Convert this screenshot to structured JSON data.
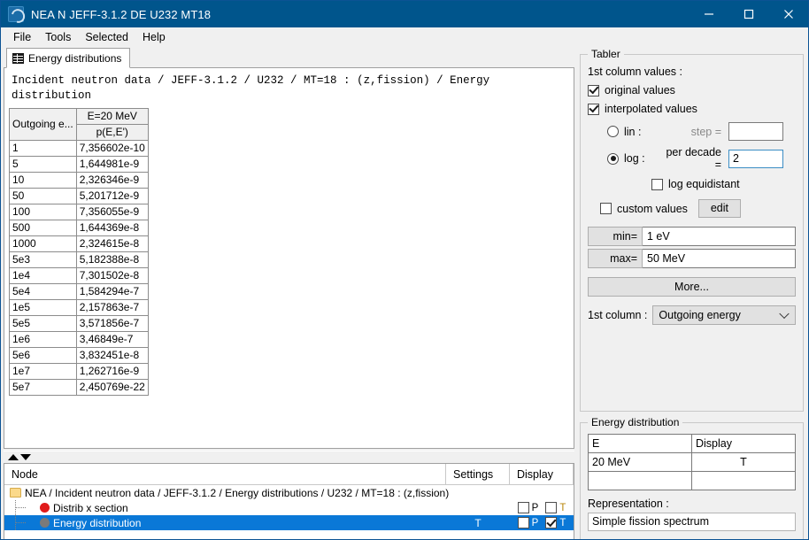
{
  "window": {
    "title": "NEA N JEFF-3.1.2 DE U232 MT18",
    "app_icon": "app-logo-icon",
    "minimize": "minimize-icon",
    "maximize": "maximize-icon",
    "close": "close-icon",
    "titlebar_color": "#00558c"
  },
  "menubar": {
    "items": [
      "File",
      "Tools",
      "Selected",
      "Help"
    ]
  },
  "tabs": [
    {
      "label": "Energy distributions",
      "icon": "grid-icon",
      "active": true
    }
  ],
  "main": {
    "header": "Incident neutron data / JEFF-3.1.2 / U232 / MT=18 : (z,fission) / Energy distribution",
    "table": {
      "col1_header": "Outgoing e...",
      "col2_header_top": "E=20 MeV",
      "col2_header_sub": "p(E,E')",
      "rows": [
        {
          "e": "1",
          "p": "7,356602e-10"
        },
        {
          "e": "5",
          "p": "1,644981e-9"
        },
        {
          "e": "10",
          "p": "2,326346e-9"
        },
        {
          "e": "50",
          "p": "5,201712e-9"
        },
        {
          "e": "100",
          "p": "7,356055e-9"
        },
        {
          "e": "500",
          "p": "1,644369e-8"
        },
        {
          "e": "1000",
          "p": "2,324615e-8"
        },
        {
          "e": "5e3",
          "p": "5,182388e-8"
        },
        {
          "e": "1e4",
          "p": "7,301502e-8"
        },
        {
          "e": "5e4",
          "p": "1,584294e-7"
        },
        {
          "e": "1e5",
          "p": "2,157863e-7"
        },
        {
          "e": "5e5",
          "p": "3,571856e-7"
        },
        {
          "e": "1e6",
          "p": "3,46849e-7"
        },
        {
          "e": "5e6",
          "p": "3,832451e-8"
        },
        {
          "e": "1e7",
          "p": "1,262716e-9"
        },
        {
          "e": "5e7",
          "p": "2,450769e-22"
        }
      ]
    }
  },
  "splitbar": {
    "up_icon": "triangle-up-icon",
    "down_icon": "triangle-down-icon"
  },
  "node_panel": {
    "columns": [
      "Node",
      "Settings",
      "Display"
    ],
    "rows": [
      {
        "label": "NEA / Incident neutron data / JEFF-3.1.2 / Energy distributions / U232 / MT=18 : (z,fission)",
        "icon": "folder-icon",
        "type": "root",
        "settings": "",
        "display_p": false,
        "display_t": false,
        "show_display": false,
        "selected": false
      },
      {
        "label": "Distrib x section",
        "icon": "red-dot-icon",
        "type": "child",
        "settings": "",
        "display_p": false,
        "display_t": false,
        "show_display": true,
        "selected": false
      },
      {
        "label": "Energy distribution",
        "icon": "grey-dot-icon",
        "type": "child",
        "settings": "T",
        "display_p": false,
        "display_t": true,
        "show_display": true,
        "selected": true
      }
    ],
    "p_label": "P",
    "t_label": "T"
  },
  "tabler": {
    "legend": "Tabler",
    "first_column_values_label": "1st column values :",
    "original_values": {
      "label": "original values",
      "checked": true
    },
    "interpolated_values": {
      "label": "interpolated values",
      "checked": true
    },
    "lin": {
      "label": "lin :",
      "selected": false
    },
    "step": {
      "label": "step =",
      "value": ""
    },
    "log": {
      "label": "log :",
      "selected": true
    },
    "per_decade": {
      "label": "per decade =",
      "value": "2"
    },
    "log_equidistant": {
      "label": "log equidistant",
      "checked": false
    },
    "custom_values": {
      "label": "custom values",
      "checked": false
    },
    "edit_button": "edit",
    "min": {
      "label": "min=",
      "value": "1 eV"
    },
    "max": {
      "label": "max=",
      "value": "50 MeV"
    },
    "more_button": "More...",
    "first_column": {
      "label": "1st column :",
      "value": "Outgoing energy",
      "chevron": "chevron-down-icon"
    }
  },
  "energy_distribution": {
    "legend": "Energy distribution",
    "columns": [
      "E",
      "Display"
    ],
    "rows": [
      {
        "e": "20 MeV",
        "display": "T"
      },
      {
        "e": "",
        "display": ""
      }
    ],
    "representation_label": "Representation :",
    "representation_value": "Simple fission spectrum"
  }
}
